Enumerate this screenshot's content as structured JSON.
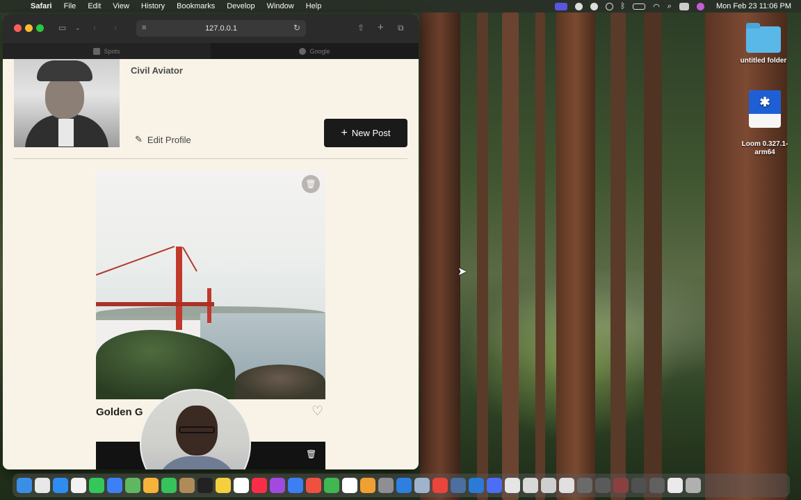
{
  "menubar": {
    "app": "Safari",
    "items": [
      "File",
      "Edit",
      "View",
      "History",
      "Bookmarks",
      "Develop",
      "Window",
      "Help"
    ],
    "clock": "Mon Feb 23  11:06 PM"
  },
  "browser": {
    "url": "127.0.0.1",
    "tabs": [
      {
        "label": "Spots",
        "active": false
      },
      {
        "label": "Google",
        "active": true
      }
    ]
  },
  "profile": {
    "role": "Civil Aviator",
    "edit_label": "Edit Profile",
    "new_post_label": "New Post"
  },
  "posts": [
    {
      "title": "Golden G"
    }
  ],
  "desktop": {
    "icons": [
      {
        "label": "untitled folder"
      },
      {
        "label": "Loom 0.327.1-\narm64"
      }
    ]
  },
  "colors": {
    "page_bg": "#f9f3e7",
    "button_bg": "#1a1a1a",
    "trash_circle": "#b9b6b2"
  },
  "dock": {
    "icons": [
      "finder-icon",
      "launchpad-icon",
      "safari-icon",
      "notes-icon",
      "messages-icon",
      "mail-icon",
      "maps-icon",
      "photos-icon",
      "facetime-icon",
      "contacts-icon",
      "appletv-icon",
      "notes2-icon",
      "freeform-icon",
      "music-icon",
      "podcasts-icon",
      "keynote-icon",
      "news-icon",
      "numbers-icon",
      "calendar-icon",
      "pages-icon",
      "settings-icon",
      "xcode-icon",
      "preview-icon",
      "chrome-icon",
      "vm-icon",
      "vscode-icon",
      "loom-icon",
      "doc-icon",
      "doc2-icon",
      "doc3-icon",
      "doc4-icon",
      "window-icon",
      "window2-icon",
      "window3-icon",
      "window4-icon",
      "window5-icon",
      "doc5-icon",
      "trash-icon"
    ]
  }
}
